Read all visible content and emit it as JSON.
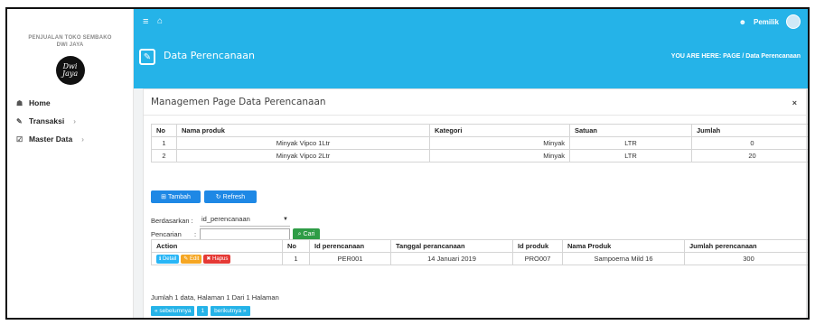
{
  "sidebar": {
    "brand_line1": "PENJUALAN TOKO SEMBAKO",
    "brand_line2": "DWI JAYA",
    "logo_text": "Dwi Jaya",
    "items": [
      {
        "label": "Home",
        "icon": "home-icon"
      },
      {
        "label": "Transaksi",
        "icon": "pencil-icon"
      },
      {
        "label": "Master Data",
        "icon": "edit-icon"
      }
    ]
  },
  "header": {
    "user_name": "Pemilik"
  },
  "page": {
    "title": "Data Perencanaan",
    "breadcrumb_prefix": "YOU ARE HERE:",
    "breadcrumb_page": "PAGE",
    "breadcrumb_sep": "/",
    "breadcrumb_current": "Data Perencanaan"
  },
  "panel": {
    "title": "Managemen Page Data Perencanaan",
    "close": "×"
  },
  "items_table": {
    "headers": [
      "No",
      "Nama produk",
      "Kategori",
      "Satuan",
      "Jumlah"
    ],
    "rows": [
      [
        "1",
        "Minyak Vipco 1Ltr",
        "Minyak",
        "LTR",
        "0"
      ],
      [
        "2",
        "Minyak Vipco 2Ltr",
        "Minyak",
        "LTR",
        "20"
      ]
    ]
  },
  "toolbar": {
    "add_label": "Tambah",
    "refresh_label": "Refresh"
  },
  "filter": {
    "by_label": "Berdasarkan :",
    "by_value": "id_perencanaan",
    "search_label": "Pencarian",
    "search_colon": ":",
    "search_value": "",
    "search_button": "Cari"
  },
  "plan_table": {
    "headers": [
      "Action",
      "No",
      "Id perencanaan",
      "Tanggal perancanaan",
      "Id produk",
      "Nama Produk",
      "Jumlah perencanaan"
    ],
    "actions": {
      "detail": "Detail",
      "edit": "Edit",
      "delete": "Hapus"
    },
    "rows": [
      [
        "1",
        "PER001",
        "14 Januari 2019",
        "PRO007",
        "Sampoerna Mild 16",
        "300"
      ]
    ]
  },
  "summary": "Jumlah 1 data, Halaman 1 Dari 1 Halaman",
  "pagination": {
    "prev": "« sebelumnya",
    "page": "1",
    "next": "berikutnya »"
  },
  "colors": {
    "accent": "#25b3e8",
    "primary": "#1e88e5",
    "success": "#2e9c46",
    "danger": "#e53935",
    "warning": "#f5a623",
    "info": "#29b6f6"
  }
}
